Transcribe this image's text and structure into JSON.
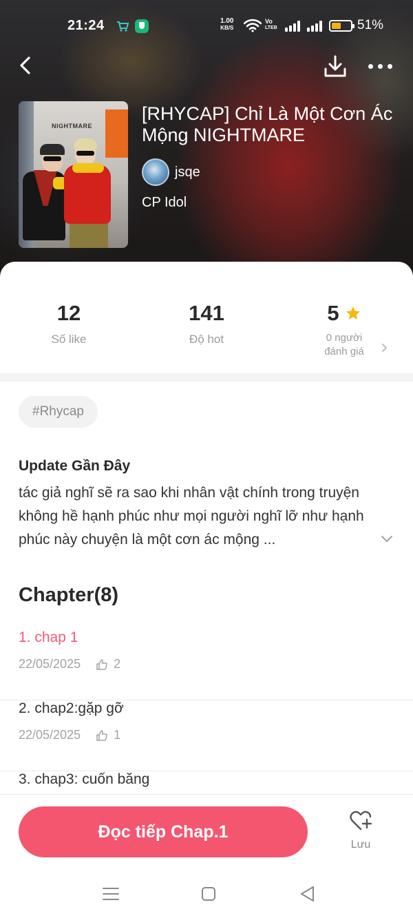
{
  "status_bar": {
    "time": "21:24",
    "net_speed_value": "1.00",
    "net_speed_unit": "KB/S",
    "volte_top": "Vo",
    "volte_bottom": "LTEB",
    "battery_percent_text": "51%",
    "battery_level": 0.51,
    "battery_color": "#f2b21b"
  },
  "header": {
    "back_icon": "chevron-left-icon",
    "download_icon": "download-icon",
    "more_icon": "more-horizontal-icon"
  },
  "story": {
    "cover_sign_text": "NIGHTMARE",
    "title": "[RHYCAP] Chỉ Là Một Cơn Ác Mộng NIGHTMARE",
    "author": "jsqe",
    "category": "CP Idol"
  },
  "stats": {
    "likes_value": "12",
    "likes_label": "Số like",
    "hot_value": "141",
    "hot_label": "Độ hot",
    "rating_value": "5",
    "rating_line1": "0 người",
    "rating_line2": "đánh giá",
    "star_color": "#f6b70f"
  },
  "tags": [
    "#Rhycap"
  ],
  "update": {
    "title": "Update Gần Đây",
    "body": "tác giả nghĩ sẽ ra sao khi nhân vật chính trong truyện không hề hạnh phúc như mọi người nghĩ lỡ như hạnh phúc này chuyện là một cơn ác mộng ..."
  },
  "chapters_header": "Chapter(8)",
  "chapters": [
    {
      "title": "1. chap 1",
      "date": "22/05/2025",
      "likes": "2",
      "active": true
    },
    {
      "title": "2. chap2:gặp gỡ",
      "date": "22/05/2025",
      "likes": "1",
      "active": false
    },
    {
      "title": "3. chap3: cuốn băng",
      "date": "",
      "likes": "",
      "active": false
    }
  ],
  "bottom": {
    "read_button": "Đọc tiếp Chap.1",
    "save_label": "Lưu",
    "accent_color": "#f4566f",
    "active_chapter_color": "#ef5c75"
  }
}
